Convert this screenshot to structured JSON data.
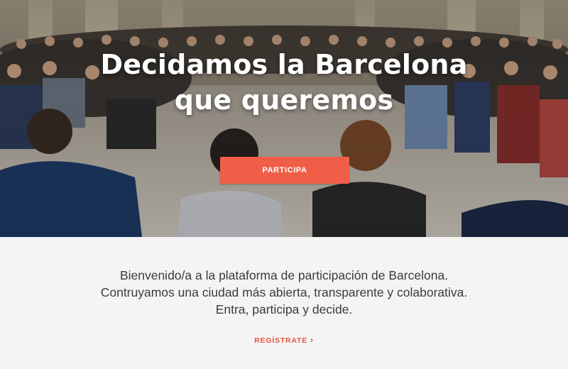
{
  "hero": {
    "title_line_1": "Decidamos la Barcelona",
    "title_line_2": "que queremos",
    "cta_label": "PARTICIPA",
    "image": "photo of a large seated public assembly meeting in a hall"
  },
  "intro": {
    "line_1": "Bienvenido/a a la plataforma de participación de Barcelona.",
    "line_2": "Contruyamos una ciudad más abierta, transparente y colaborativa.",
    "line_3": "Entra, participa y decide."
  },
  "register": {
    "label": "REGÍSTRATE",
    "icon": "chevron-right-icon",
    "chevron_glyph": "›"
  },
  "colors": {
    "accent": "#f15e48",
    "link": "#e8563f",
    "intro_bg": "#f4f4f4",
    "text": "#3b3b3b"
  }
}
